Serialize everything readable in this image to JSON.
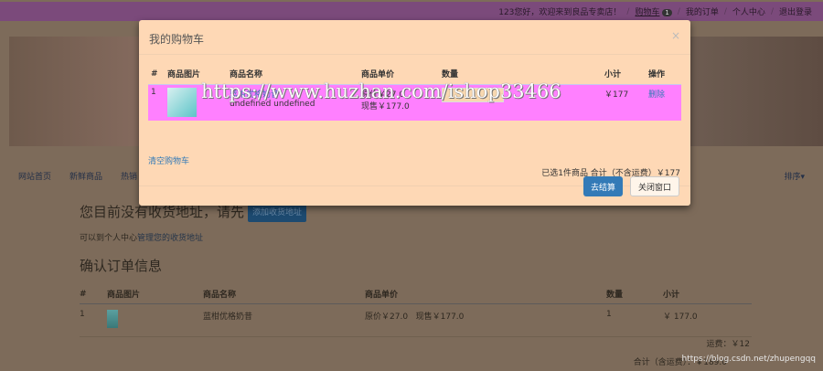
{
  "topbar": {
    "greeting": "123您好，欢迎来到良品专卖店！",
    "cart": "购物车",
    "cart_count": "1",
    "orders": "我的订单",
    "profile": "个人中心",
    "logout": "退出登录",
    "sep": "/"
  },
  "nav": {
    "items": [
      "网站首页",
      "新鲜商品",
      "热销"
    ],
    "sort": "排序▾"
  },
  "main": {
    "no_address": "您目前没有收货地址，请先",
    "add_address": "添加收货地址",
    "hint_prefix": "可以到个人中心",
    "hint_link": "管理您的收货地址",
    "confirm_title": "确认订单信息",
    "columns": [
      "#",
      "商品图片",
      "商品名称",
      "商品单价",
      "数量",
      "小计"
    ],
    "rows": [
      {
        "index": "1",
        "name": "蓝柑优格奶昔",
        "price": "原价￥27.0   现售￥177.0",
        "qty": "1",
        "subtotal": "￥ 177.0"
      }
    ],
    "shipping": "运费：￥12",
    "total": "合计（含运费）：￥189.0"
  },
  "modal": {
    "title": "我的购物车",
    "close": "×",
    "columns": [
      "#",
      "商品图片",
      "商品名称",
      "商品单价",
      "数量",
      "小计",
      "操作"
    ],
    "rows": [
      {
        "index": "1",
        "name": "蓝柑优格奶昔",
        "spec": "undefined  undefined",
        "orig": "原价￥27.0",
        "now": "现售￥177.0",
        "subtotal": "￥177",
        "action": "删除"
      }
    ],
    "clear": "清空购物车",
    "summary": "已选1件商品  合计（不含运费）￥177",
    "checkout": "去结算",
    "close_btn": "关闭窗口"
  },
  "watermark": "https://www.huzhan.com/ishop33466",
  "csdn": "https://blog.csdn.net/zhupengqq"
}
